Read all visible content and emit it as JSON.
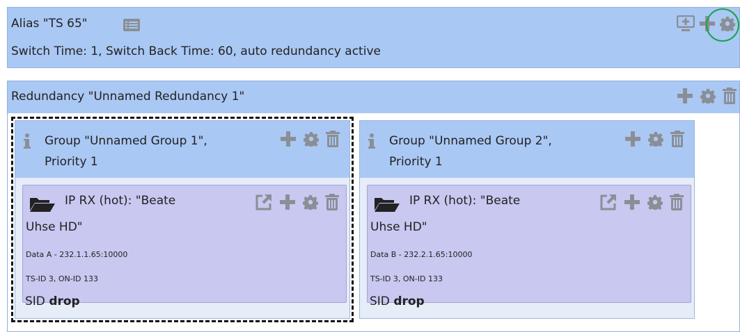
{
  "alias": {
    "title": "Alias \"TS 65\"",
    "subtitle": "Switch Time: 1, Switch Back Time: 60, auto redundancy active",
    "icons": [
      "list-icon",
      "monitor-add-icon",
      "plus-icon",
      "gear-icon"
    ]
  },
  "redundancy": {
    "title": "Redundancy \"Unnamed Redundancy 1\"",
    "icons": [
      "plus-icon",
      "gear-icon",
      "trash-icon"
    ]
  },
  "groups": [
    {
      "title_line1": "Group \"Unnamed Group 1\",",
      "title_line2": "Priority 1",
      "selected": true,
      "card": {
        "title_line1": "IP RX (hot): \"Beate",
        "title_line2": "Uhse HD\"",
        "data": "Data A - 232.1.1.65:10000",
        "ts": "TS-ID 3, ON-ID 133",
        "sid_label": "SID",
        "sid_value": "drop"
      }
    },
    {
      "title_line1": "Group \"Unnamed Group 2\",",
      "title_line2": "Priority 1",
      "selected": false,
      "card": {
        "title_line1": "IP RX (hot): \"Beate",
        "title_line2": "Uhse HD\"",
        "data": "Data B - 232.2.1.65:10000",
        "ts": "TS-ID 3, ON-ID 133",
        "sid_label": "SID",
        "sid_value": "drop"
      }
    }
  ],
  "colors": {
    "header_blue": "#aac8f4",
    "card_lavender": "#c8c8f0",
    "icon_gray": "#8a8f96",
    "highlight_green": "#1aa34a"
  }
}
